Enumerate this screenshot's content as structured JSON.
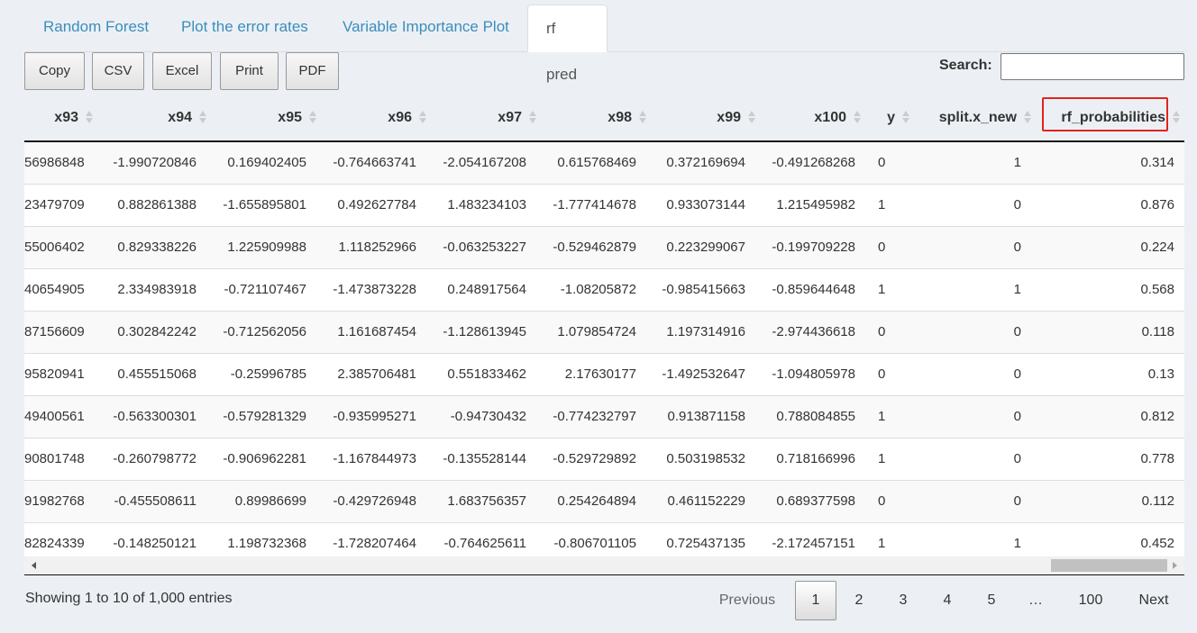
{
  "tabs": [
    "Random Forest",
    "Plot the error rates",
    "Variable Importance Plot",
    "rf pred"
  ],
  "buttons": [
    "Copy",
    "CSV",
    "Excel",
    "Print",
    "PDF"
  ],
  "search": {
    "label": "Search:",
    "value": ""
  },
  "table": {
    "columns": [
      "x93",
      "x94",
      "x95",
      "x96",
      "x97",
      "x98",
      "x99",
      "x100",
      "y",
      "split.x_new",
      "rf_probabilities"
    ],
    "rows": [
      [
        "56986848",
        "-1.990720846",
        "0.169402405",
        "-0.764663741",
        "-2.054167208",
        "0.615768469",
        "0.372169694",
        "-0.491268268",
        "0",
        "1",
        "0.314"
      ],
      [
        "23479709",
        "0.882861388",
        "-1.655895801",
        "0.492627784",
        "1.483234103",
        "-1.777414678",
        "0.933073144",
        "1.215495982",
        "1",
        "0",
        "0.876"
      ],
      [
        "55006402",
        "0.829338226",
        "1.225909988",
        "1.118252966",
        "-0.063253227",
        "-0.529462879",
        "0.223299067",
        "-0.199709228",
        "0",
        "0",
        "0.224"
      ],
      [
        "40654905",
        "2.334983918",
        "-0.721107467",
        "-1.473873228",
        "0.248917564",
        "-1.08205872",
        "-0.985415663",
        "-0.859644648",
        "1",
        "1",
        "0.568"
      ],
      [
        "87156609",
        "0.302842242",
        "-0.712562056",
        "1.161687454",
        "-1.128613945",
        "1.079854724",
        "1.197314916",
        "-2.974436618",
        "0",
        "0",
        "0.118"
      ],
      [
        "95820941",
        "0.455515068",
        "-0.25996785",
        "2.385706481",
        "0.551833462",
        "2.17630177",
        "-1.492532647",
        "-1.094805978",
        "0",
        "0",
        "0.13"
      ],
      [
        "49400561",
        "-0.563300301",
        "-0.579281329",
        "-0.935995271",
        "-0.94730432",
        "-0.774232797",
        "0.913871158",
        "0.788084855",
        "1",
        "0",
        "0.812"
      ],
      [
        "90801748",
        "-0.260798772",
        "-0.906962281",
        "-1.167844973",
        "-0.135528144",
        "-0.529729892",
        "0.503198532",
        "0.718166996",
        "1",
        "0",
        "0.778"
      ],
      [
        "91982768",
        "-0.455508611",
        "0.89986699",
        "-0.429726948",
        "1.683756357",
        "0.254264894",
        "0.461152229",
        "0.689377598",
        "0",
        "0",
        "0.112"
      ],
      [
        "82824339",
        "-0.148250121",
        "1.198732368",
        "-1.728207464",
        "-0.764625611",
        "-0.806701105",
        "0.725437135",
        "-2.172457151",
        "1",
        "1",
        "0.452"
      ]
    ]
  },
  "info": "Showing 1 to 10 of 1,000 entries",
  "pagination": {
    "previous": "Previous",
    "pages": [
      "1",
      "2",
      "3",
      "4",
      "5",
      "…",
      "100"
    ],
    "current": "1",
    "next": "Next"
  },
  "colors": {
    "accent": "#3c8dbc",
    "highlight": "#e3231e",
    "background": "#ecf0f5"
  }
}
